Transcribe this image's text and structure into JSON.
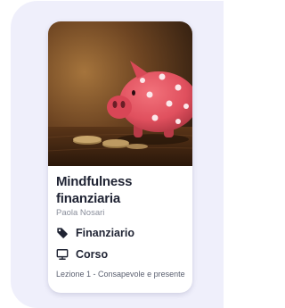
{
  "course_card": {
    "title": "Mindfulness finanziaria",
    "author": "Paola Nosari",
    "category": {
      "icon": "tag-icon",
      "label": "Finanziario"
    },
    "format": {
      "icon": "monitor-icon",
      "label": "Corso"
    },
    "lesson": "Lezione 1 - Consapevole e presente",
    "image": "piggy-bank-photo"
  },
  "colors": {
    "backdrop": "#efeffb",
    "card_bg": "#ffffff",
    "text_primary": "#1f2333",
    "text_muted": "#8a8f9c",
    "piggy": "#e0505e"
  }
}
